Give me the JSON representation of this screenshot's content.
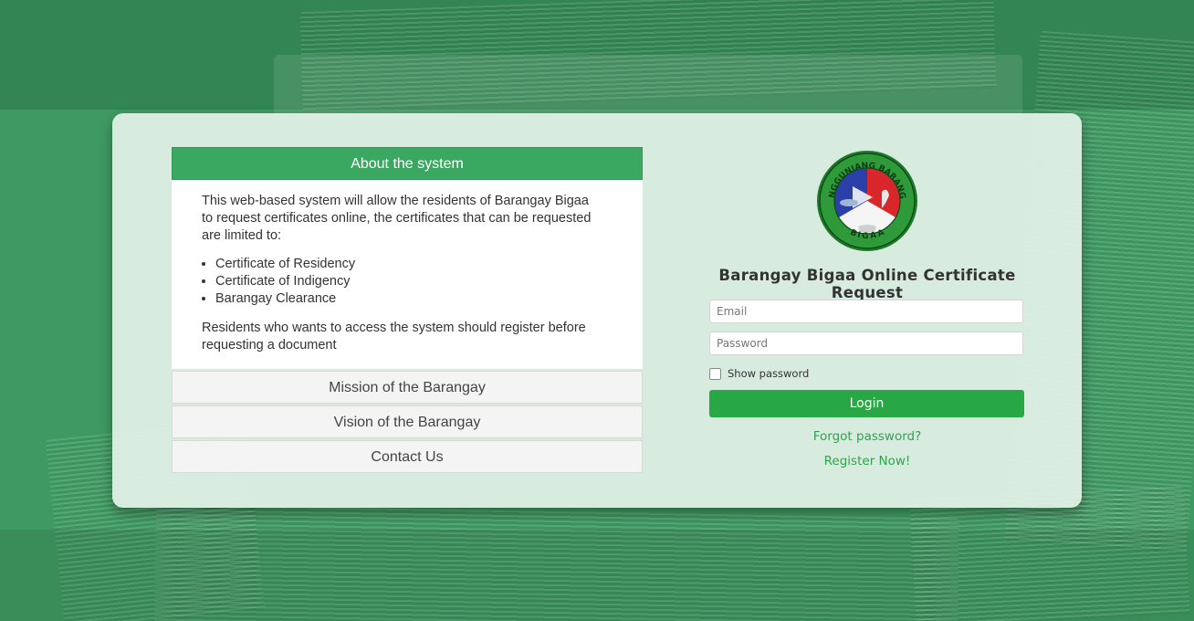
{
  "accordion": {
    "active_header": "About the system",
    "about": {
      "intro": "This web-based system will allow the residents of Barangay Bigaa to request certificates online, the certificates that can be requested are limited to:",
      "items": [
        "Certificate of Residency",
        "Certificate of Indigency",
        "Barangay Clearance"
      ],
      "outro": "Residents who wants to access the system should register before requesting a document"
    },
    "mission_label": "Mission of the Barangay",
    "vision_label": "Vision of the Barangay",
    "contact_label": "Contact Us"
  },
  "login": {
    "logo_top_text": "SANGGUNIANG BARANGAY",
    "logo_bottom_text": "BIGAA",
    "title": "Barangay Bigaa Online Certificate Request",
    "email_placeholder": "Email",
    "password_placeholder": "Password",
    "show_password_label": "Show password",
    "login_label": "Login",
    "forgot_label": "Forgot password?",
    "register_label": "Register Now!"
  },
  "colors": {
    "background": "#3f9a62",
    "accent": "#3aa860",
    "button": "#28a745",
    "link": "#2fa44f"
  }
}
